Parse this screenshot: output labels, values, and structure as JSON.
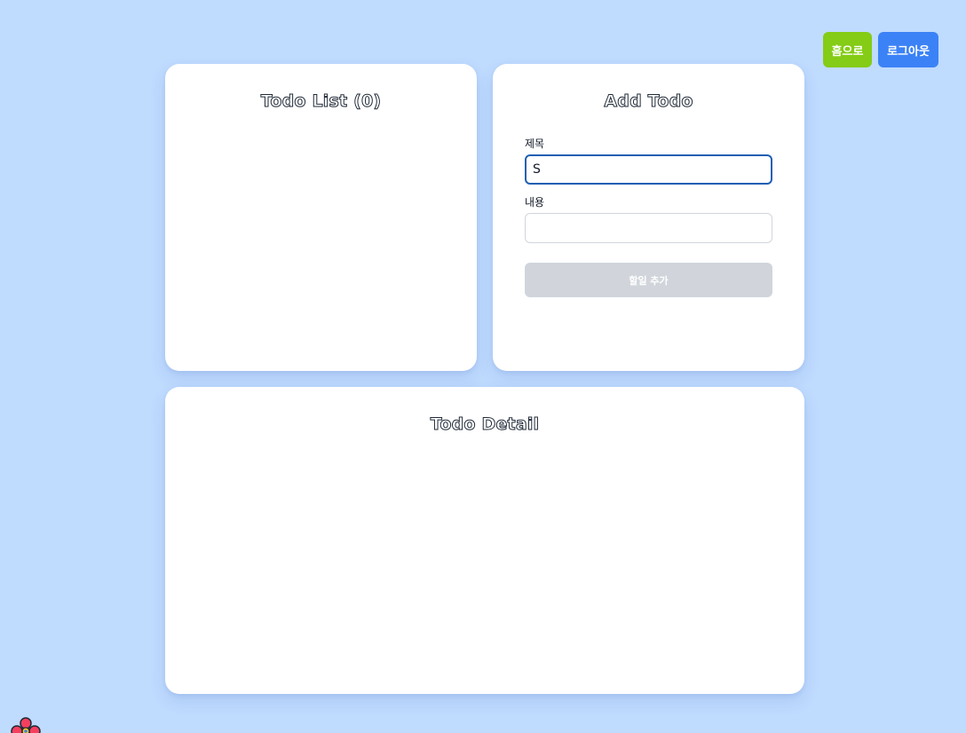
{
  "header": {
    "home_label": "홈으로",
    "logout_label": "로그아웃"
  },
  "todo_list": {
    "title": "Todo List (0)",
    "items": []
  },
  "add_todo": {
    "title": "Add Todo",
    "title_label": "제목",
    "title_value": "S",
    "content_label": "내용",
    "content_value": "",
    "submit_label": "할일 추가"
  },
  "todo_detail": {
    "title": "Todo Detail"
  },
  "colors": {
    "background": "#bfdbfe",
    "home_button": "#84cc16",
    "logout_button": "#3b82f6",
    "submit_disabled": "#d1d5db",
    "focus_border": "#1d5fb3"
  },
  "icons": {
    "corner_logo": "flower-logo-icon"
  }
}
